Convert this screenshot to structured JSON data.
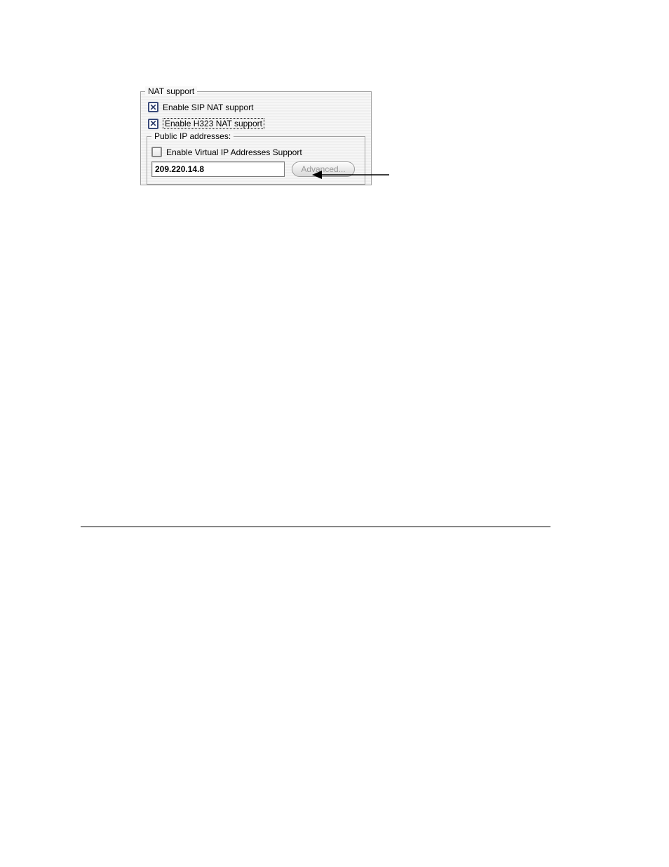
{
  "nat_support": {
    "legend": "NAT support",
    "enable_sip": {
      "label": "Enable SIP NAT support",
      "checked": true
    },
    "enable_h323": {
      "label": "Enable H323 NAT support",
      "checked": true,
      "focused": true
    },
    "public_ip": {
      "legend": "Public IP addresses:",
      "enable_virtual": {
        "label": "Enable Virtual IP Addresses Support",
        "checked": false
      },
      "ip_value": "209.220.14.8",
      "advanced_label": "Advanced..."
    }
  }
}
